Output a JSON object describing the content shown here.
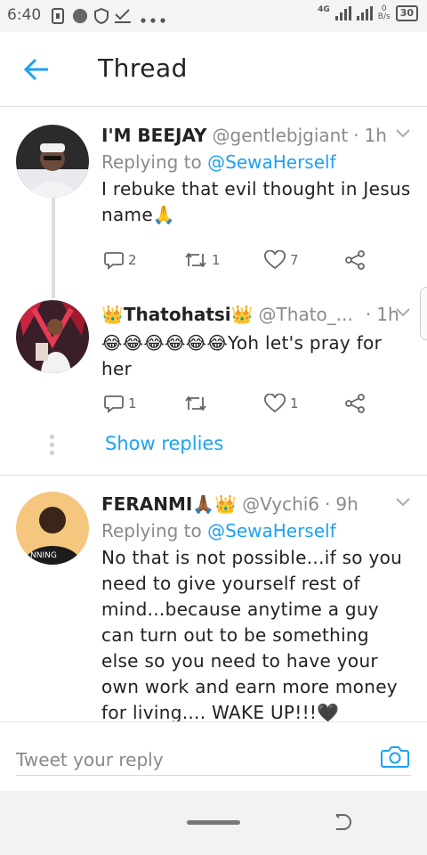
{
  "status_bar": {
    "time": "6:40",
    "network": "4G",
    "speed_value": "0",
    "speed_unit": "B/s",
    "battery": "30"
  },
  "header": {
    "title": "Thread"
  },
  "tweets": [
    {
      "name": "I'M BEEJAY",
      "handle": "@gentlebjgiant",
      "time": "1h",
      "replying_prefix": "Replying to",
      "replying_to": "@SewaHerself",
      "text": "I rebuke that evil thought in Jesus name🙏",
      "replies": "2",
      "retweets": "1",
      "likes": "7"
    },
    {
      "name": "👑Thatohatsi👑",
      "handle": "@Thato_...",
      "time": "1h",
      "text": "😂😂😂😂😂😂Yoh let's pray for her",
      "replies": "1",
      "retweets": "",
      "likes": "1"
    },
    {
      "name": "FERANMI🙏🏾👑",
      "handle": "@Vychi6",
      "time": "9h",
      "replying_prefix": "Replying to",
      "replying_to": "@SewaHerself",
      "text": "No that is not possible...if so you need to give yourself rest of mind...because anytime a guy can turn out to be something else so you need to have your own work and earn more money for living.... WAKE UP!!!🖤"
    }
  ],
  "show_replies": "Show replies",
  "reply_bar": {
    "placeholder": "Tweet your reply"
  },
  "colors": {
    "accent": "#1da1f2",
    "muted": "#8a8a8a",
    "divider": "#e1e1e1"
  },
  "icons": [
    "back-arrow-icon",
    "chevron-down-icon",
    "reply-icon",
    "retweet-icon",
    "like-icon",
    "share-icon",
    "camera-icon"
  ]
}
